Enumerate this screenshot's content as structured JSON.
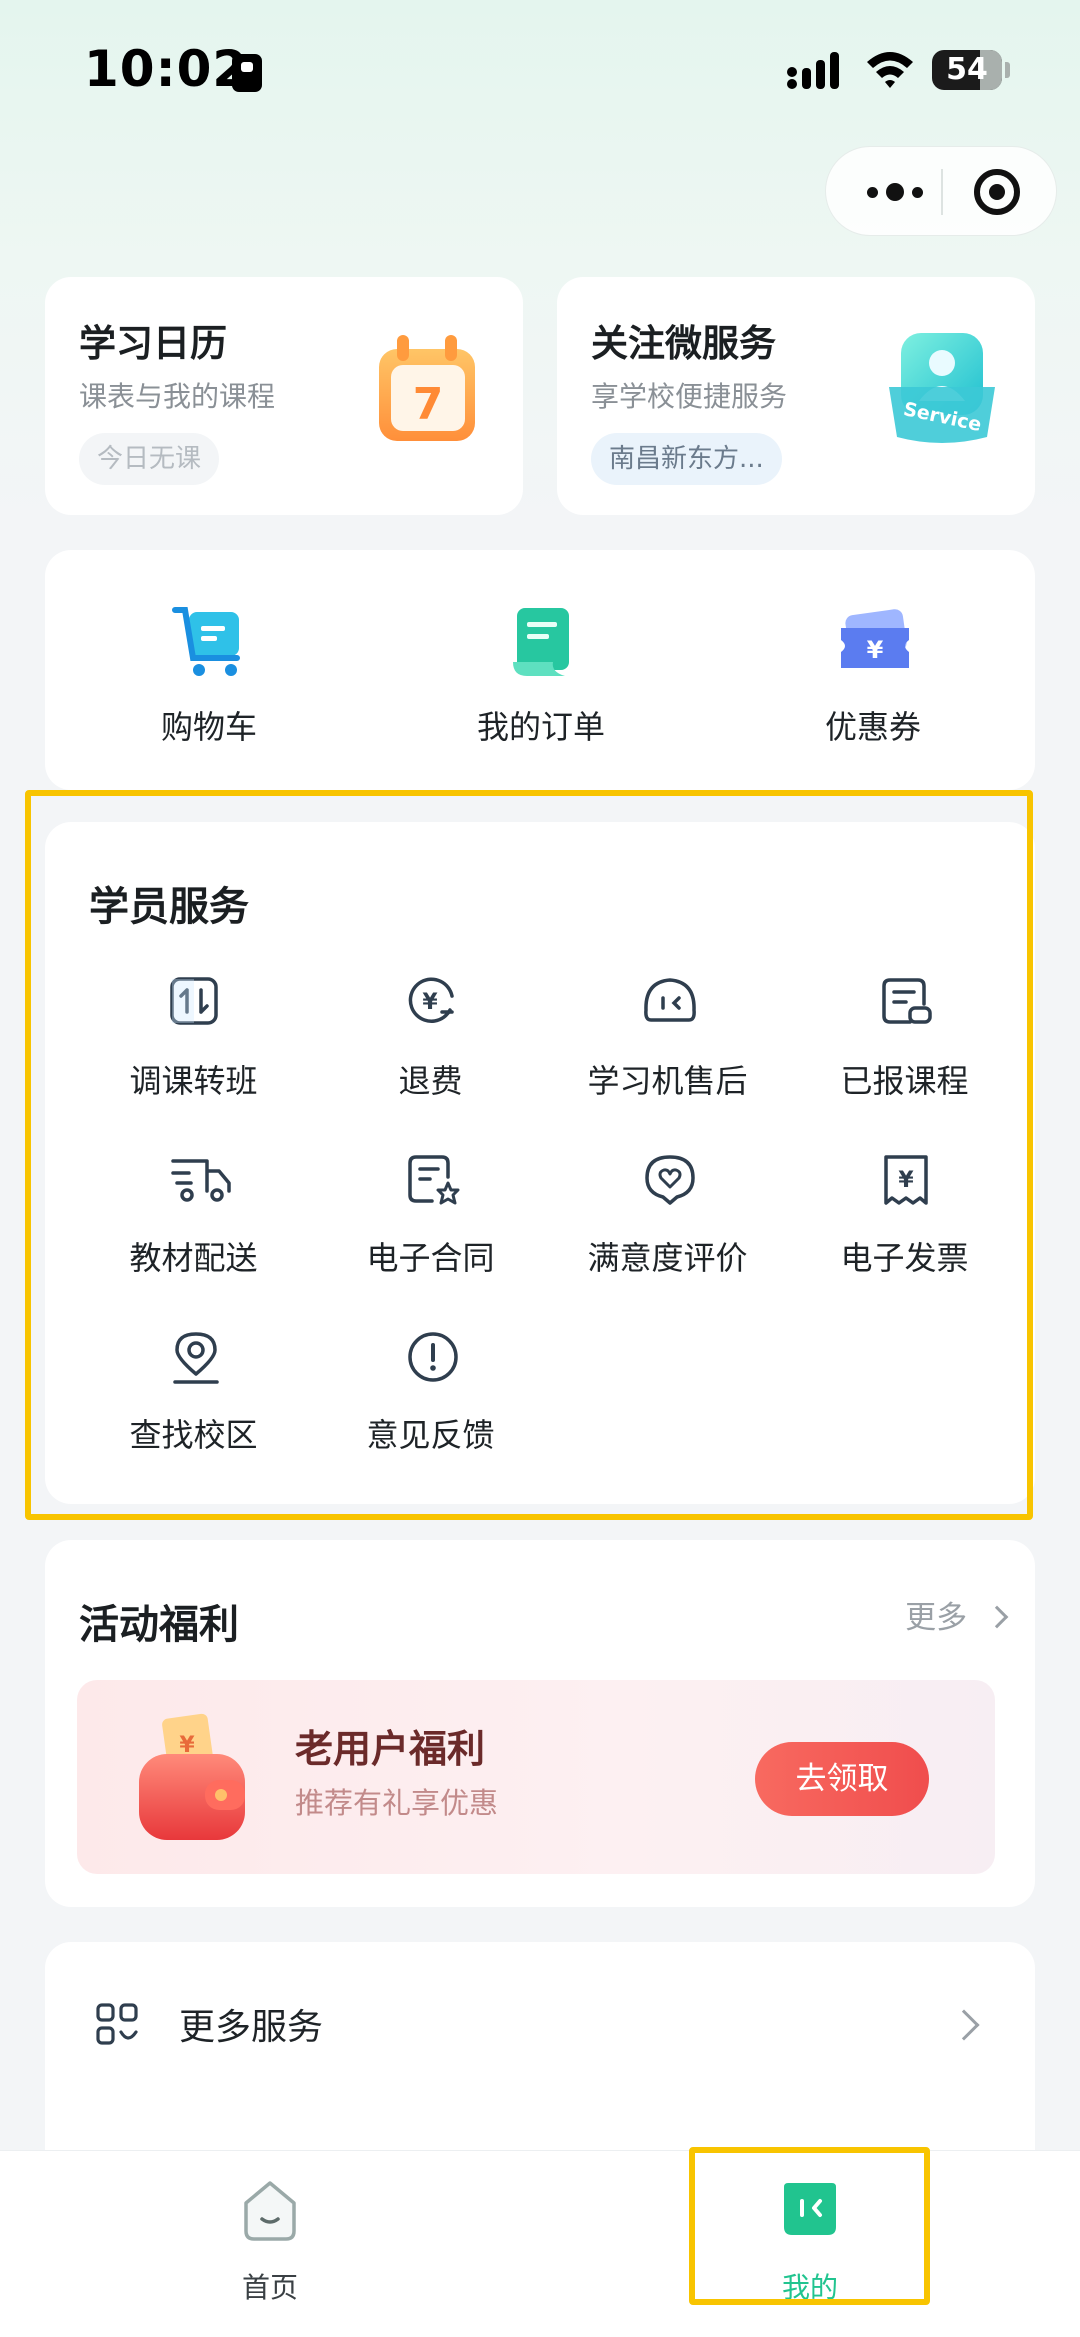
{
  "status_bar": {
    "time": "10:02",
    "battery": "54"
  },
  "calendar_card": {
    "title": "学习日历",
    "subtitle": "课表与我的课程",
    "chip": "今日无课",
    "art_number": "7"
  },
  "service_card": {
    "title": "关注微服务",
    "subtitle": "享学校便捷服务",
    "chip": "南昌新东方...",
    "art_text": "Service"
  },
  "quick_actions": [
    {
      "label": "购物车",
      "icon": "shopping-cart-icon"
    },
    {
      "label": "我的订单",
      "icon": "order-document-icon"
    },
    {
      "label": "优惠券",
      "icon": "coupon-icon"
    }
  ],
  "student_services": {
    "title": "学员服务",
    "items": [
      {
        "label": "调课转班",
        "icon": "swap-class-icon"
      },
      {
        "label": "退费",
        "icon": "refund-icon"
      },
      {
        "label": "学习机售后",
        "icon": "device-aftersales-icon"
      },
      {
        "label": "已报课程",
        "icon": "enrolled-courses-icon"
      },
      {
        "label": "教材配送",
        "icon": "delivery-truck-icon"
      },
      {
        "label": "电子合同",
        "icon": "contract-icon"
      },
      {
        "label": "满意度评价",
        "icon": "heart-chat-icon"
      },
      {
        "label": "电子发票",
        "icon": "invoice-icon"
      },
      {
        "label": "查找校区",
        "icon": "location-pin-icon"
      },
      {
        "label": "意见反馈",
        "icon": "feedback-icon"
      }
    ]
  },
  "activity": {
    "title": "活动福利",
    "more": "更多",
    "promo": {
      "title": "老用户福利",
      "subtitle": "推荐有礼享优惠",
      "button": "去领取"
    }
  },
  "more_services": {
    "label": "更多服务"
  },
  "tabbar": {
    "tabs": [
      {
        "label": "首页",
        "active": false
      },
      {
        "label": "我的",
        "active": true
      }
    ]
  },
  "colors": {
    "accent": "#21c48f",
    "highlight": "#f8c400",
    "promo_button": "#f2554f"
  }
}
